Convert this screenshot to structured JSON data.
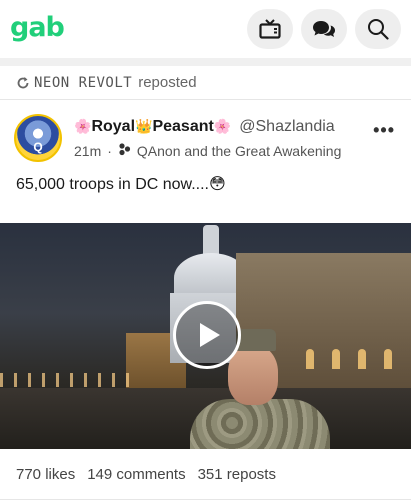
{
  "header": {
    "logo": "gab",
    "icons": [
      "tv-icon",
      "chat-icon",
      "search-icon"
    ]
  },
  "repost": {
    "icon": "repost-icon",
    "reposter": "NEON REVOLT",
    "text": "reposted"
  },
  "post": {
    "avatar_text": "Q",
    "display_name_prefix": "🌸",
    "display_name_part1": "Royal",
    "display_name_crown": "👑",
    "display_name_part2": "Peasant",
    "display_name_suffix": "🌸",
    "handle": "@Shazlandia",
    "time": "21m",
    "dot": "·",
    "group_icon": "group-icon",
    "group": "QAnon and the Great Awakening",
    "more": "•••",
    "body": "65,000 troops in DC now....😳"
  },
  "video": {
    "play_icon": "play-icon"
  },
  "stats": {
    "likes": "770 likes",
    "comments": "149 comments",
    "reposts": "351 reposts"
  },
  "colors": {
    "brand": "#21cf7a",
    "button_bg": "#eeeeee",
    "muted_text": "#555555"
  }
}
